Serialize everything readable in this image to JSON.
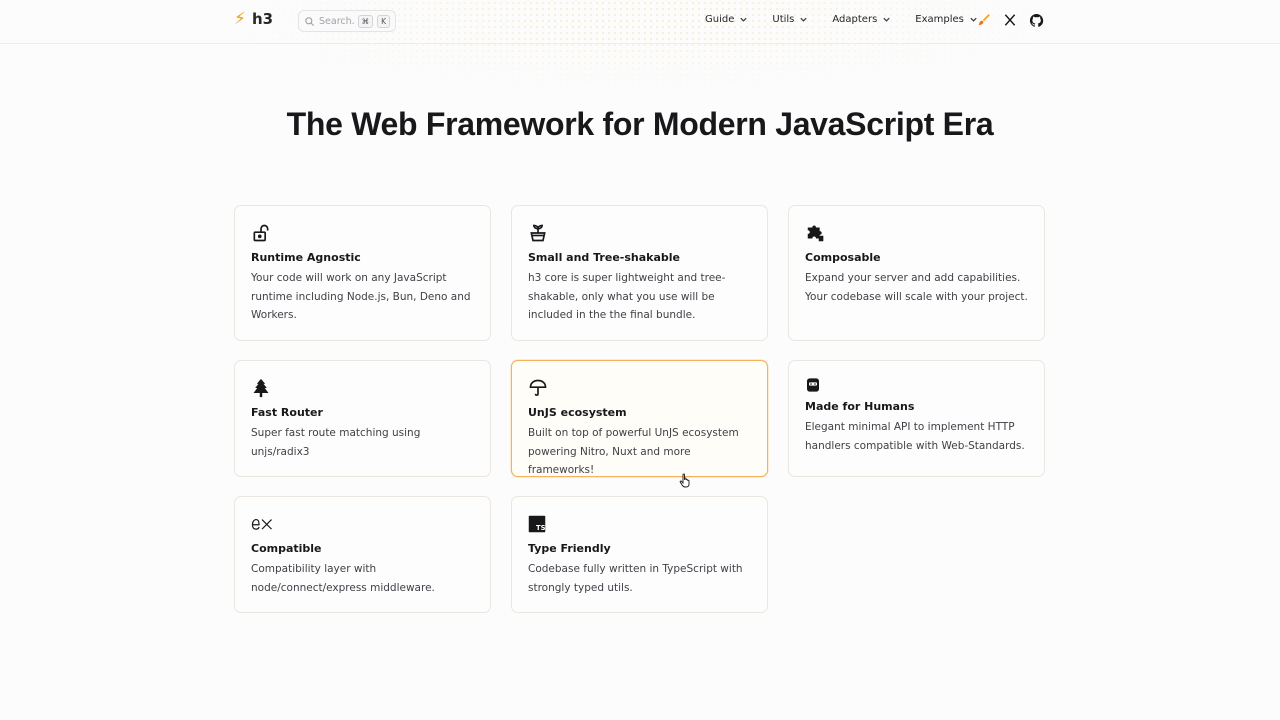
{
  "app": {
    "logo_text": "h3",
    "search": {
      "placeholder": "Search...",
      "shortcut_cmd": "⌘",
      "shortcut_key": "K"
    },
    "nav": [
      {
        "label": "Guide"
      },
      {
        "label": "Utils"
      },
      {
        "label": "Adapters"
      },
      {
        "label": "Examples"
      }
    ],
    "header_icons": [
      "brush-icon",
      "x-twitter-icon",
      "github-icon"
    ],
    "accent_color": "#f59e0b"
  },
  "hero": {
    "title": "The Web Framework for Modern JavaScript Era"
  },
  "features": [
    {
      "icon": "unlock-icon",
      "title": "Runtime Agnostic",
      "description": "Your code will work on any JavaScript runtime including Node.js, Bun, Deno and Workers."
    },
    {
      "icon": "plant-pot-icon",
      "title": "Small and Tree-shakable",
      "description": "h3 core is super lightweight and tree-shakable, only what you use will be included in the the final bundle."
    },
    {
      "icon": "puzzle-icon",
      "title": "Composable",
      "description": "Expand your server and add capabilities. Your codebase will scale with your project."
    },
    {
      "icon": "tree-icon",
      "title": "Fast Router",
      "description": "Super fast route matching using unjs/radix3"
    },
    {
      "icon": "umbrella-icon",
      "title": "UnJS ecosystem",
      "description": "Built on top of powerful UnJS ecosystem powering Nitro, Nuxt and more frameworks!"
    },
    {
      "icon": "robot-icon",
      "title": "Made for Humans",
      "description": "Elegant minimal API to implement HTTP handlers compatible with Web-Standards."
    },
    {
      "icon": "express-icon",
      "title": "Compatible",
      "description": "Compatibility layer with node/connect/express middleware."
    },
    {
      "icon": "typescript-icon",
      "title": "Type Friendly",
      "description": "Codebase fully written in TypeScript with strongly typed utils."
    }
  ]
}
